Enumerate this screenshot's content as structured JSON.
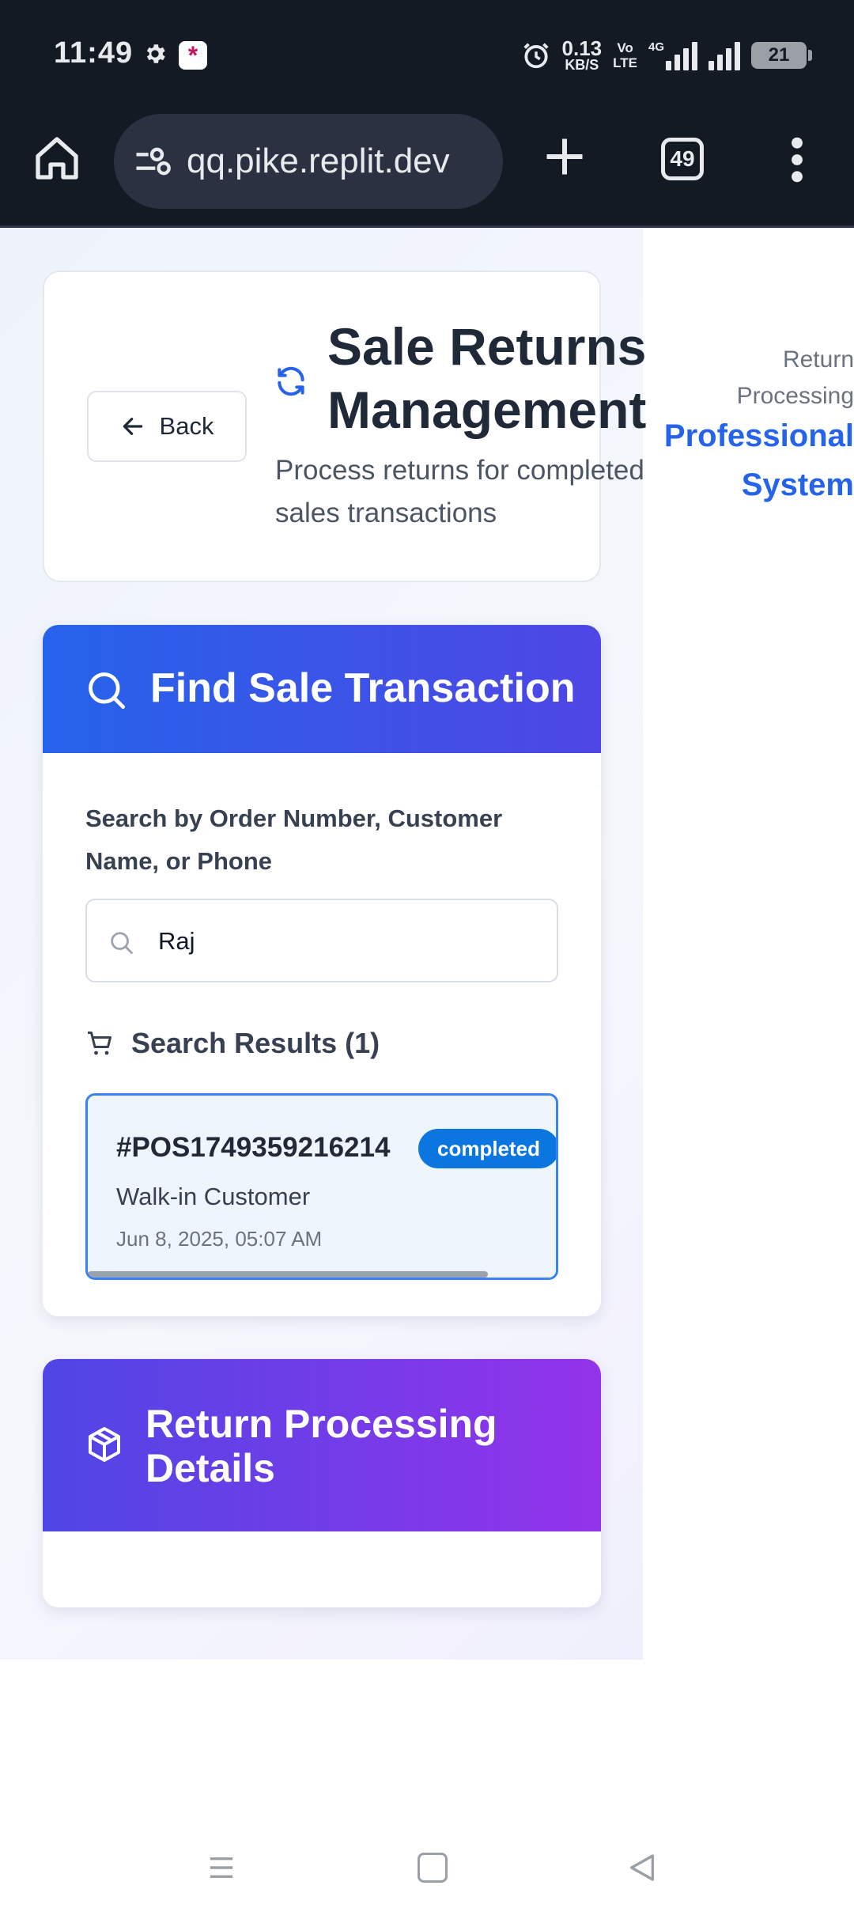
{
  "status_bar": {
    "time": "11:49",
    "net_speed_value": "0.13",
    "net_speed_unit": "KB/S",
    "volte_top": "Vo",
    "volte_bottom": "LTE",
    "network_type": "4G",
    "battery": "21"
  },
  "browser": {
    "url": "qq.pike.replit.dev",
    "tab_count": "49"
  },
  "header": {
    "back_label": "Back",
    "title": "Sale Returns Management",
    "subtitle": "Process returns for completed sales transactions",
    "side_small": "Return Processing",
    "side_big": "Professional System"
  },
  "find": {
    "title": "Find Sale Transaction",
    "search_label": "Search by Order Number, Customer Name, or Phone",
    "search_value": "Raj",
    "results_heading": "Search Results (1)",
    "results": [
      {
        "order_number": "#POS1749359216214",
        "status": "completed",
        "customer": "Walk-in Customer",
        "date": "Jun 8, 2025, 05:07 AM"
      }
    ]
  },
  "processing": {
    "title": "Return Processing Details"
  },
  "colors": {
    "primary_blue": "#2563eb",
    "indigo": "#4f46e5",
    "purple": "#9333ea",
    "badge_blue": "#0b76e0",
    "status_bar_bg": "#141a24"
  },
  "icons": {
    "home": "home-icon",
    "site_settings": "tune-icon",
    "new_tab": "plus-icon",
    "menu": "more-vert-icon",
    "refresh": "refresh-icon",
    "search": "search-icon",
    "cart": "cart-icon",
    "package": "package-icon"
  }
}
